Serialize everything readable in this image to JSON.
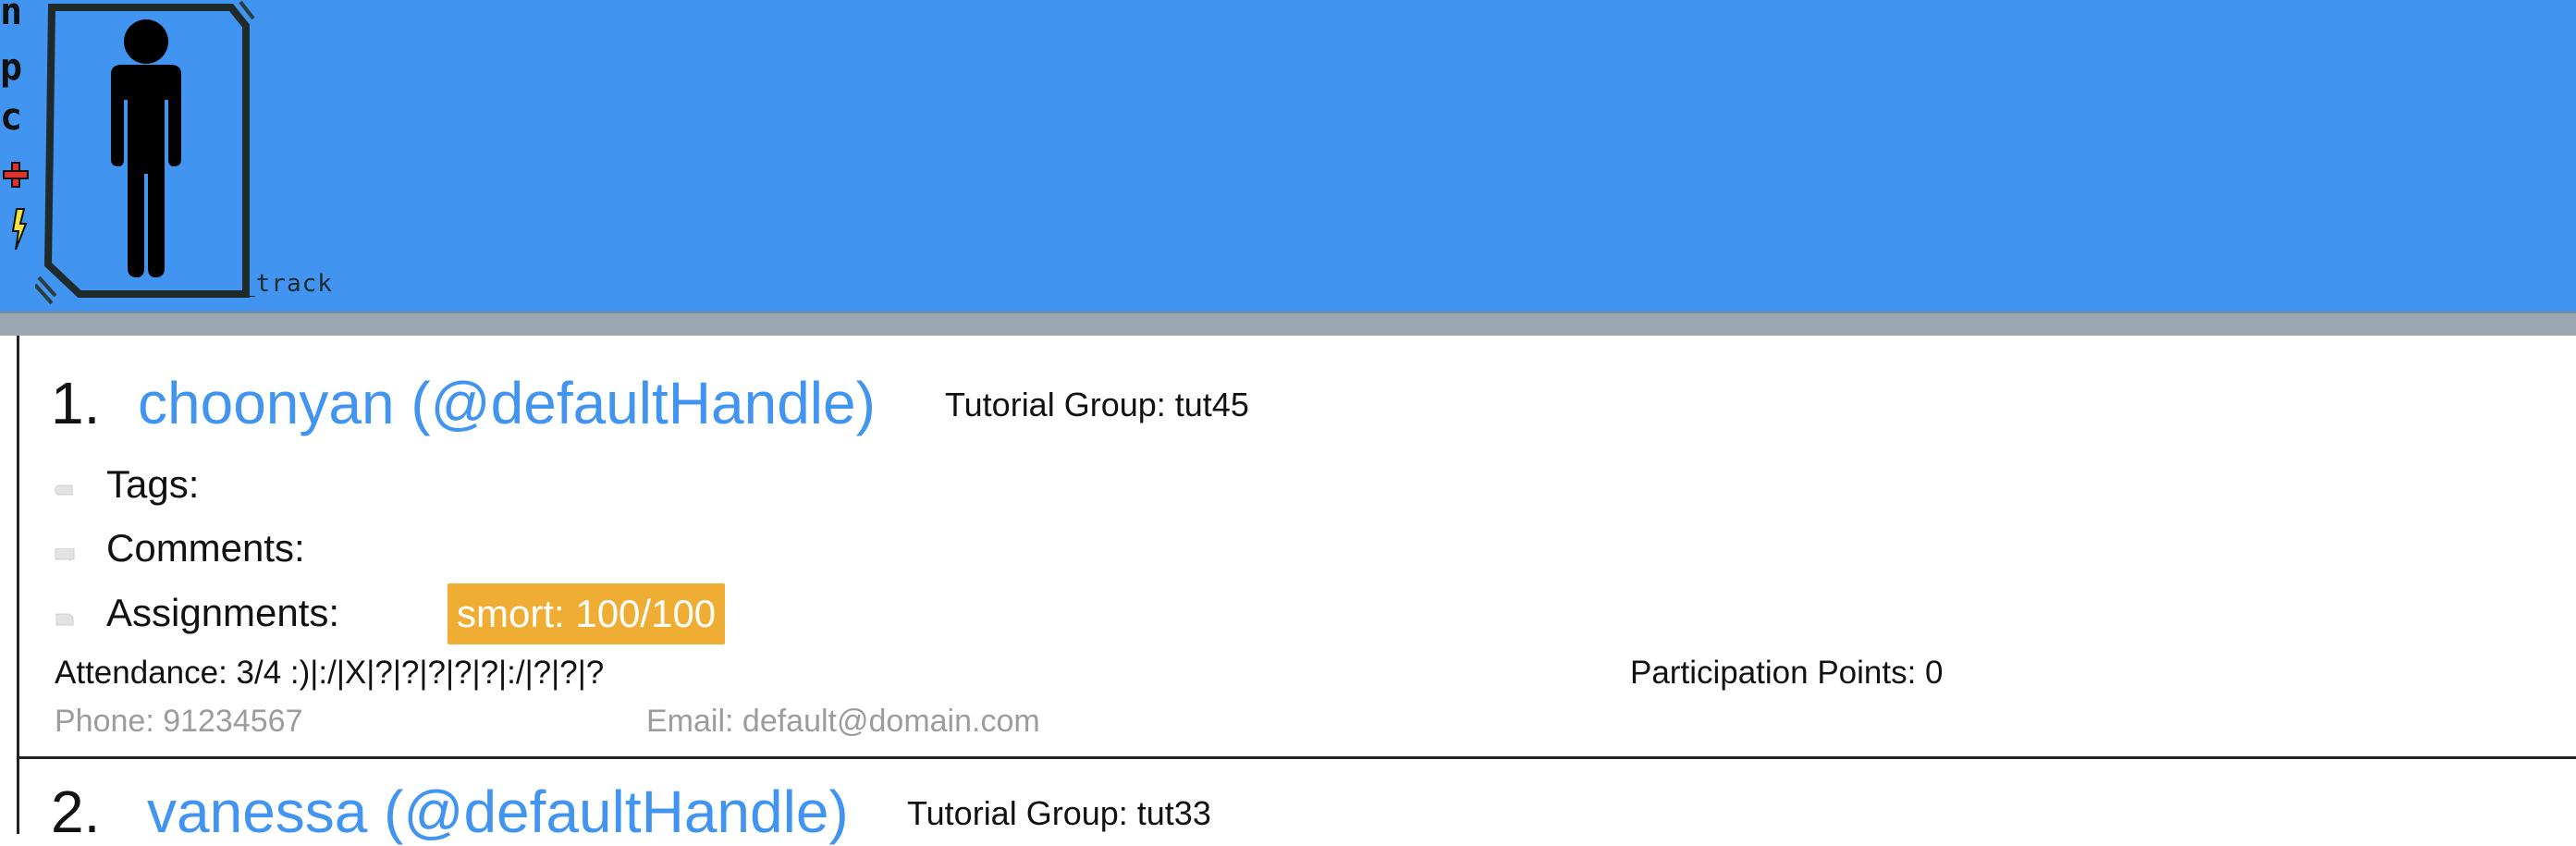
{
  "app": {
    "logo_letters": [
      "n",
      "p",
      "c"
    ],
    "logo_track": "_track"
  },
  "persons": [
    {
      "index": "1.",
      "name": "choonyan (@defaultHandle)",
      "tutorial_group": "Tutorial Group: tut45",
      "tags_label": "Tags:",
      "comments_label": "Comments:",
      "assignments_label": "Assignments:",
      "assignments": [
        "smort: 100/100"
      ],
      "attendance": "Attendance: 3/4  :)|:/|X|?|?|?|?|?|:/|?|?|?",
      "participation": "Participation Points: 0",
      "phone": "Phone: 91234567",
      "email": "Email: default@domain.com"
    },
    {
      "index": "2.",
      "name": "vanessa (@defaultHandle)",
      "tutorial_group": "Tutorial Group: tut33"
    }
  ],
  "colors": {
    "header": "#4194ef",
    "name": "#4194ef",
    "badge": "#f0ad33"
  }
}
